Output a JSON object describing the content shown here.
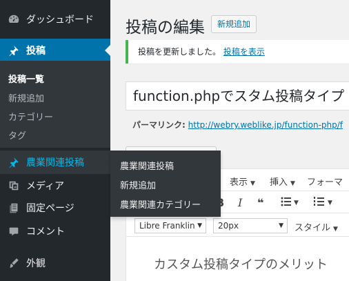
{
  "sidebar": {
    "items": [
      {
        "label": "ダッシュボード",
        "icon": "dashboard-icon"
      },
      {
        "label": "投稿",
        "icon": "pin-icon"
      },
      {
        "label": "農業関連投稿",
        "icon": "pin-icon"
      },
      {
        "label": "メディア",
        "icon": "media-icon"
      },
      {
        "label": "固定ページ",
        "icon": "page-icon"
      },
      {
        "label": "コメント",
        "icon": "comment-icon"
      },
      {
        "label": "外観",
        "icon": "appearance-icon"
      }
    ],
    "posts_submenu": [
      {
        "label": "投稿一覧"
      },
      {
        "label": "新規追加"
      },
      {
        "label": "カテゴリー"
      },
      {
        "label": "タグ"
      }
    ],
    "flyout": [
      {
        "label": "農業関連投稿"
      },
      {
        "label": "新規追加"
      },
      {
        "label": "農業関連カテゴリー"
      }
    ]
  },
  "header": {
    "title": "投稿の編集",
    "add_new_label": "新規追加"
  },
  "notice": {
    "message": "投稿を更新しました。",
    "link_text": "投稿を表示"
  },
  "post": {
    "title_value": "function.phpでスタム投稿タイプ",
    "permalink_label": "パーマリンク:",
    "permalink_url": "http://webry.weblike.jp/function-php/f"
  },
  "editor": {
    "menubar": {
      "view": "表示",
      "insert": "挿入",
      "format": "フォーマ"
    },
    "font_family": "Libre Franklin",
    "font_size": "20px",
    "style_label": "スタイル",
    "body_text": "カスタム投稿タイプのメリット"
  },
  "colors": {
    "sidebar_bg": "#23282d",
    "accent": "#0073aa",
    "notice_success": "#46b450"
  }
}
